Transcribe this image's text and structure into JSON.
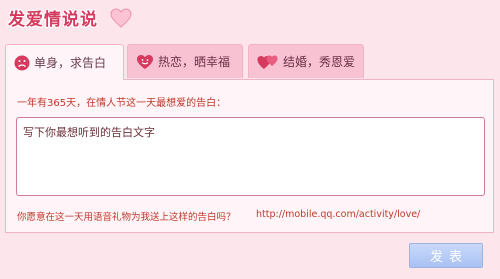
{
  "app": {
    "title": "发爱情说说"
  },
  "tabs": [
    {
      "label": "单身，求告白",
      "icon": "sad-face-icon",
      "active": true
    },
    {
      "label": "热恋，晒幸福",
      "icon": "heart-face-icon",
      "active": false
    },
    {
      "label": "结婚，秀恩爱",
      "icon": "double-heart-icon",
      "active": false
    }
  ],
  "composer": {
    "prompt": "一年有365天，在情人节这一天最想爱的告白：",
    "placeholder": "写下你最想听到的告白文字",
    "question": "你愿意在这一天用语音礼物为我送上这样的告白吗？",
    "link": "http://mobile.qq.com/activity/love/"
  },
  "actions": {
    "submit_label": "发表"
  },
  "colors": {
    "accent": "#d63a5f",
    "background": "#fde5ec",
    "tab_inactive": "#f8c2d3",
    "button": "#b3c9f5"
  }
}
